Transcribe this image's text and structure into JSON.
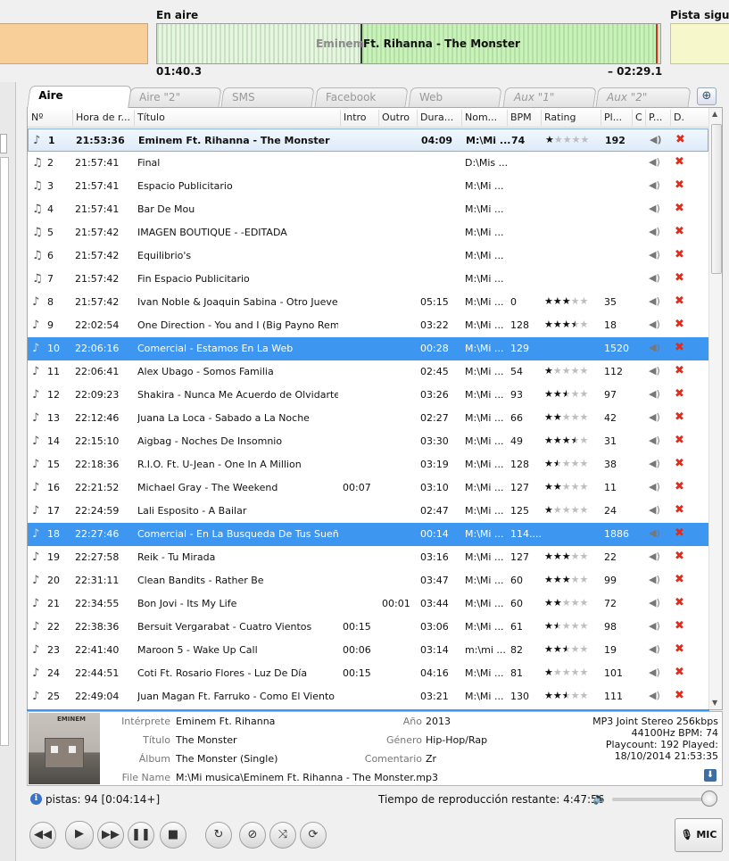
{
  "header": {
    "on_air_label": "En aire",
    "next_track_label": "Pista siguiente",
    "wave_artist": "Eminem",
    "wave_title": "Ft. Rihanna - The Monster",
    "elapsed": "01:40.3",
    "remaining": "– 02:29.1",
    "progress_fraction": 0.4
  },
  "tabs": [
    {
      "label": "Aire",
      "active": true
    },
    {
      "label": "Aire \"2\""
    },
    {
      "label": "SMS"
    },
    {
      "label": "Facebook"
    },
    {
      "label": "Web"
    },
    {
      "label": "Aux \"1\"",
      "italic": true
    },
    {
      "label": "Aux \"2\"",
      "italic": true
    }
  ],
  "tab_add_icon": "plus-icon",
  "columns": [
    "Nº",
    "Hora de r...",
    "Título",
    "Intro",
    "Outro",
    "Dura...",
    "Nom...",
    "BPM",
    "Rating",
    "Pl...",
    "C",
    "P...",
    "D."
  ],
  "rows": [
    {
      "n": "1",
      "time": "21:53:36",
      "title": "Eminem Ft. Rihanna - The Monster",
      "intro": "",
      "outro": "",
      "dur": "04:09",
      "path": "M:\\Mi ...",
      "bpm": "74",
      "rating": 1,
      "plays": "192",
      "state": "current",
      "icon": "music-note-icon"
    },
    {
      "n": "2",
      "time": "21:57:41",
      "title": "Final",
      "intro": "",
      "outro": "",
      "dur": "",
      "path": "D:\\Mis ...",
      "bpm": "",
      "rating": null,
      "plays": "",
      "icon": "scheduled-note-icon"
    },
    {
      "n": "3",
      "time": "21:57:41",
      "title": "Espacio Publicitario",
      "intro": "",
      "outro": "",
      "dur": "",
      "path": "M:\\Mi ...",
      "bpm": "",
      "rating": null,
      "plays": "",
      "icon": "scheduled-note-icon"
    },
    {
      "n": "4",
      "time": "21:57:41",
      "title": "Bar De Mou",
      "intro": "",
      "outro": "",
      "dur": "",
      "path": "M:\\Mi ...",
      "bpm": "",
      "rating": null,
      "plays": "",
      "icon": "scheduled-note-icon"
    },
    {
      "n": "5",
      "time": "21:57:42",
      "title": "IMAGEN BOUTIQUE - -EDITADA",
      "intro": "",
      "outro": "",
      "dur": "",
      "path": "M:\\Mi ...",
      "bpm": "",
      "rating": null,
      "plays": "",
      "icon": "scheduled-note-icon"
    },
    {
      "n": "6",
      "time": "21:57:42",
      "title": "Equilibrio's",
      "intro": "",
      "outro": "",
      "dur": "",
      "path": "M:\\Mi ...",
      "bpm": "",
      "rating": null,
      "plays": "",
      "icon": "scheduled-note-icon"
    },
    {
      "n": "7",
      "time": "21:57:42",
      "title": "Fin Espacio Publicitario",
      "intro": "",
      "outro": "",
      "dur": "",
      "path": "M:\\Mi ...",
      "bpm": "",
      "rating": null,
      "plays": "",
      "icon": "scheduled-note-icon"
    },
    {
      "n": "8",
      "time": "21:57:42",
      "title": "Ivan Noble & Joaquin Sabina - Otro Jueves ...",
      "intro": "",
      "outro": "",
      "dur": "05:15",
      "path": "M:\\Mi ...",
      "bpm": "0",
      "rating": 3,
      "plays": "35",
      "icon": "music-note-icon"
    },
    {
      "n": "9",
      "time": "22:02:54",
      "title": "One Direction - You and I (Big Payno Remix)",
      "intro": "",
      "outro": "",
      "dur": "03:22",
      "path": "M:\\Mi ...",
      "bpm": "128",
      "rating": 3.5,
      "plays": "18",
      "icon": "music-note-icon"
    },
    {
      "n": "10",
      "time": "22:06:16",
      "title": "Comercial - Estamos En La Web",
      "intro": "",
      "outro": "",
      "dur": "00:28",
      "path": "M:\\Mi ...",
      "bpm": "129",
      "rating": null,
      "plays": "1520",
      "state": "selected",
      "icon": "music-note-icon"
    },
    {
      "n": "11",
      "time": "22:06:41",
      "title": "Alex Ubago - Somos Familia",
      "intro": "",
      "outro": "",
      "dur": "02:45",
      "path": "M:\\Mi ...",
      "bpm": "54",
      "rating": 1,
      "plays": "112",
      "icon": "music-note-icon"
    },
    {
      "n": "12",
      "time": "22:09:23",
      "title": "Shakira - Nunca Me Acuerdo de Olvidarte",
      "intro": "",
      "outro": "",
      "dur": "03:26",
      "path": "M:\\Mi ...",
      "bpm": "93",
      "rating": 2.5,
      "plays": "97",
      "icon": "music-note-icon"
    },
    {
      "n": "13",
      "time": "22:12:46",
      "title": "Juana La Loca - Sabado a La Noche",
      "intro": "",
      "outro": "",
      "dur": "02:27",
      "path": "M:\\Mi ...",
      "bpm": "66",
      "rating": 2,
      "plays": "42",
      "icon": "music-note-icon"
    },
    {
      "n": "14",
      "time": "22:15:10",
      "title": "Aigbag - Noches De Insomnio",
      "intro": "",
      "outro": "",
      "dur": "03:30",
      "path": "M:\\Mi ...",
      "bpm": "49",
      "rating": 3.5,
      "plays": "31",
      "icon": "music-note-icon"
    },
    {
      "n": "15",
      "time": "22:18:36",
      "title": "R.I.O. Ft. U-Jean - One In A Million",
      "intro": "",
      "outro": "",
      "dur": "03:19",
      "path": "M:\\Mi ...",
      "bpm": "128",
      "rating": 1.5,
      "plays": "38",
      "icon": "music-note-icon"
    },
    {
      "n": "16",
      "time": "22:21:52",
      "title": "Michael Gray - The Weekend",
      "intro": "00:07",
      "outro": "",
      "dur": "03:10",
      "path": "M:\\Mi ...",
      "bpm": "127",
      "rating": 2,
      "plays": "11",
      "icon": "music-note-icon"
    },
    {
      "n": "17",
      "time": "22:24:59",
      "title": "Lali Esposito - A Bailar",
      "intro": "",
      "outro": "",
      "dur": "02:47",
      "path": "M:\\Mi ...",
      "bpm": "125",
      "rating": 1,
      "plays": "24",
      "icon": "music-note-icon"
    },
    {
      "n": "18",
      "time": "22:27:46",
      "title": "Comercial - En La Busqueda De Tus Sueño",
      "intro": "",
      "outro": "",
      "dur": "00:14",
      "path": "M:\\Mi ...",
      "bpm": "114....",
      "rating": null,
      "plays": "1886",
      "state": "selected",
      "icon": "music-note-icon"
    },
    {
      "n": "19",
      "time": "22:27:58",
      "title": "Reik - Tu Mirada",
      "intro": "",
      "outro": "",
      "dur": "03:16",
      "path": "M:\\Mi ...",
      "bpm": "127",
      "rating": 3,
      "plays": "22",
      "icon": "music-note-icon"
    },
    {
      "n": "20",
      "time": "22:31:11",
      "title": "Clean Bandits - Rather Be",
      "intro": "",
      "outro": "",
      "dur": "03:47",
      "path": "M:\\Mi ...",
      "bpm": "60",
      "rating": 3,
      "plays": "99",
      "icon": "music-note-icon"
    },
    {
      "n": "21",
      "time": "22:34:55",
      "title": "Bon Jovi - Its My Life",
      "intro": "",
      "outro": "00:01",
      "dur": "03:44",
      "path": "M:\\Mi ...",
      "bpm": "60",
      "rating": 2,
      "plays": "72",
      "icon": "music-note-icon"
    },
    {
      "n": "22",
      "time": "22:38:36",
      "title": "Bersuit Vergarabat - Cuatro Vientos",
      "intro": "00:15",
      "outro": "",
      "dur": "03:06",
      "path": "M:\\Mi ...",
      "bpm": "61",
      "rating": 1.5,
      "plays": "98",
      "icon": "music-note-icon"
    },
    {
      "n": "23",
      "time": "22:41:40",
      "title": "Maroon 5 - Wake Up Call",
      "intro": "00:06",
      "outro": "",
      "dur": "03:14",
      "path": "m:\\mi ...",
      "bpm": "82",
      "rating": 2.5,
      "plays": "19",
      "icon": "music-note-icon"
    },
    {
      "n": "24",
      "time": "22:44:51",
      "title": "Coti Ft. Rosario Flores - Luz De Día",
      "intro": "00:15",
      "outro": "",
      "dur": "04:16",
      "path": "M:\\Mi ...",
      "bpm": "81",
      "rating": 1,
      "plays": "101",
      "icon": "music-note-icon"
    },
    {
      "n": "25",
      "time": "22:49:04",
      "title": "Juan Magan Ft. Farruko - Como El Viento",
      "intro": "",
      "outro": "",
      "dur": "03:21",
      "path": "M:\\Mi ...",
      "bpm": "130",
      "rating": 2.5,
      "plays": "111",
      "icon": "music-note-icon"
    }
  ],
  "info": {
    "cover_text": "EMINEM",
    "labels": {
      "artist": "Intérprete",
      "title": "Título",
      "album": "Álbum",
      "filename": "File Name",
      "year": "Año",
      "genre": "Género",
      "comment": "Comentario"
    },
    "artist": "Eminem Ft. Rihanna",
    "title": "The Monster",
    "album": "The Monster (Single)",
    "filename": "M:\\Mi musica\\Eminem Ft. Rihanna - The Monster.mp3",
    "year": "2013",
    "genre": "Hip-Hop/Rap",
    "comment": "Zr",
    "tech_line1": "MP3 Joint Stereo 256kbps",
    "tech_line2": "44100Hz BPM: 74",
    "tech_line3": "Playcount: 192 Played:",
    "tech_line4": "18/10/2014 21:53:35"
  },
  "status": {
    "tracks": "pistas: 94 [0:04:14+]",
    "remaining": "Tiempo de reproducción restante: 4:47:56",
    "volume_fraction": 0.95
  },
  "player": {
    "buttons": [
      {
        "name": "rewind-icon",
        "glyph": "◀◀"
      },
      {
        "name": "play-icon",
        "glyph": "▶"
      },
      {
        "name": "fast-forward-icon",
        "glyph": "▶▶"
      },
      {
        "name": "pause-icon",
        "glyph": "❚❚"
      },
      {
        "name": "stop-icon",
        "glyph": "■"
      },
      {
        "name": "repeat-one-icon",
        "glyph": "↻"
      },
      {
        "name": "block-icon",
        "glyph": "⊘"
      },
      {
        "name": "shuffle-icon",
        "glyph": "⤨"
      },
      {
        "name": "repeat-icon",
        "glyph": "⟳"
      }
    ],
    "mic_label": "MIC"
  },
  "colors": {
    "selected_row": "#3d97f1",
    "wave_green": "#c8f3b8",
    "prev_orange": "#f8cf98",
    "next_yellow": "#f6f8cc",
    "delete_red": "#e02c1c"
  }
}
